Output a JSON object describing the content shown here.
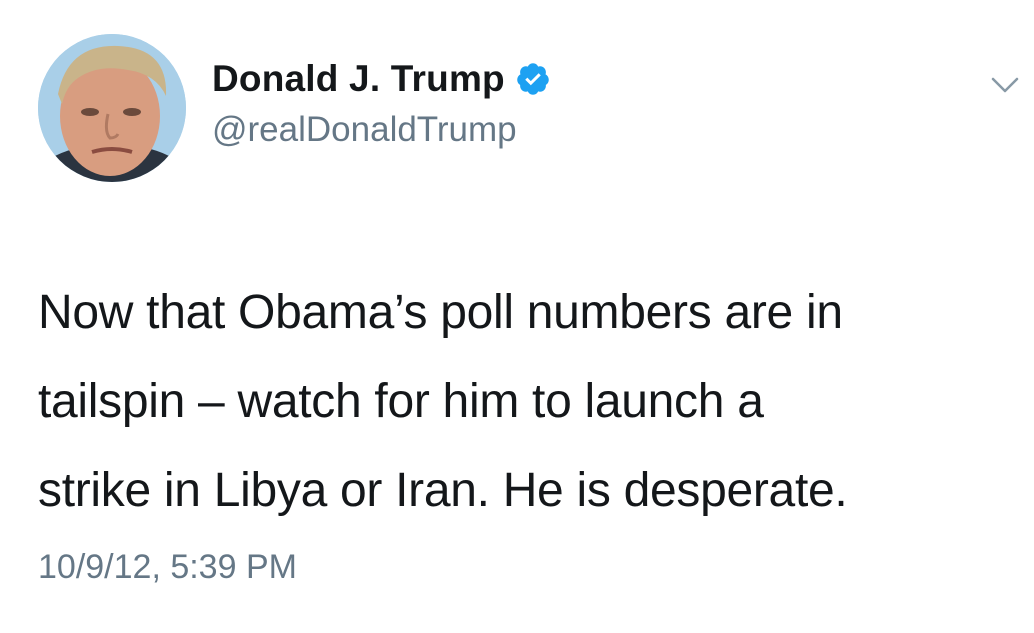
{
  "tweet": {
    "display_name": "Donald J. Trump",
    "handle": "@realDonaldTrump",
    "verified_icon": "verified-badge-icon",
    "menu_icon": "chevron-down-icon",
    "text_lines": [
      "Now that Obama’s poll numbers are in",
      "tailspin – watch for him to launch a",
      "strike in Libya or Iran.  He is desperate."
    ],
    "timestamp": "10/9/12, 5:39 PM"
  },
  "colors": {
    "verified_blue": "#1da1f2",
    "secondary_text": "#657786",
    "primary_text": "#14171a"
  }
}
